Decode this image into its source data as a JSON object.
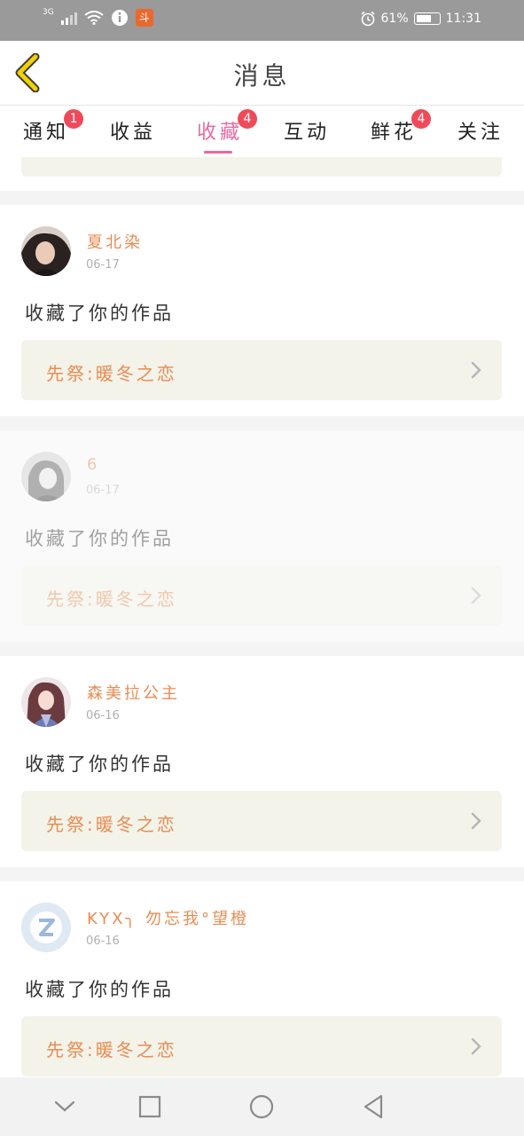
{
  "status_bar": {
    "signal_tag": "3G",
    "app_badge": "斗",
    "battery": "61%",
    "time": "11:31"
  },
  "header": {
    "title": "消息"
  },
  "tabs": [
    {
      "label": "通知",
      "badge": "1"
    },
    {
      "label": "收益",
      "badge": ""
    },
    {
      "label": "收藏",
      "badge": "4",
      "active": true
    },
    {
      "label": "互动",
      "badge": ""
    },
    {
      "label": "鲜花",
      "badge": "4"
    },
    {
      "label": "关注",
      "badge": ""
    }
  ],
  "items": [
    {
      "username": "夏北染",
      "date": "06-17",
      "action": "收藏了你的作品",
      "work": "先祭:暖冬之恋",
      "faded": false
    },
    {
      "username": "6",
      "date": "06-17",
      "action": "收藏了你的作品",
      "work": "先祭:暖冬之恋",
      "faded": true
    },
    {
      "username": "森美拉公主",
      "date": "06-16",
      "action": "收藏了你的作品",
      "work": "先祭:暖冬之恋",
      "faded": false
    },
    {
      "username": "KYX╮ 勿忘我°望橙",
      "date": "06-16",
      "action": "收藏了你的作品",
      "work": "先祭:暖冬之恋",
      "faded": false
    }
  ],
  "colors": {
    "accent": "#e86aa0",
    "username": "#e88c53",
    "badge": "#f04a5a",
    "work_bg": "#f4f3ea"
  }
}
